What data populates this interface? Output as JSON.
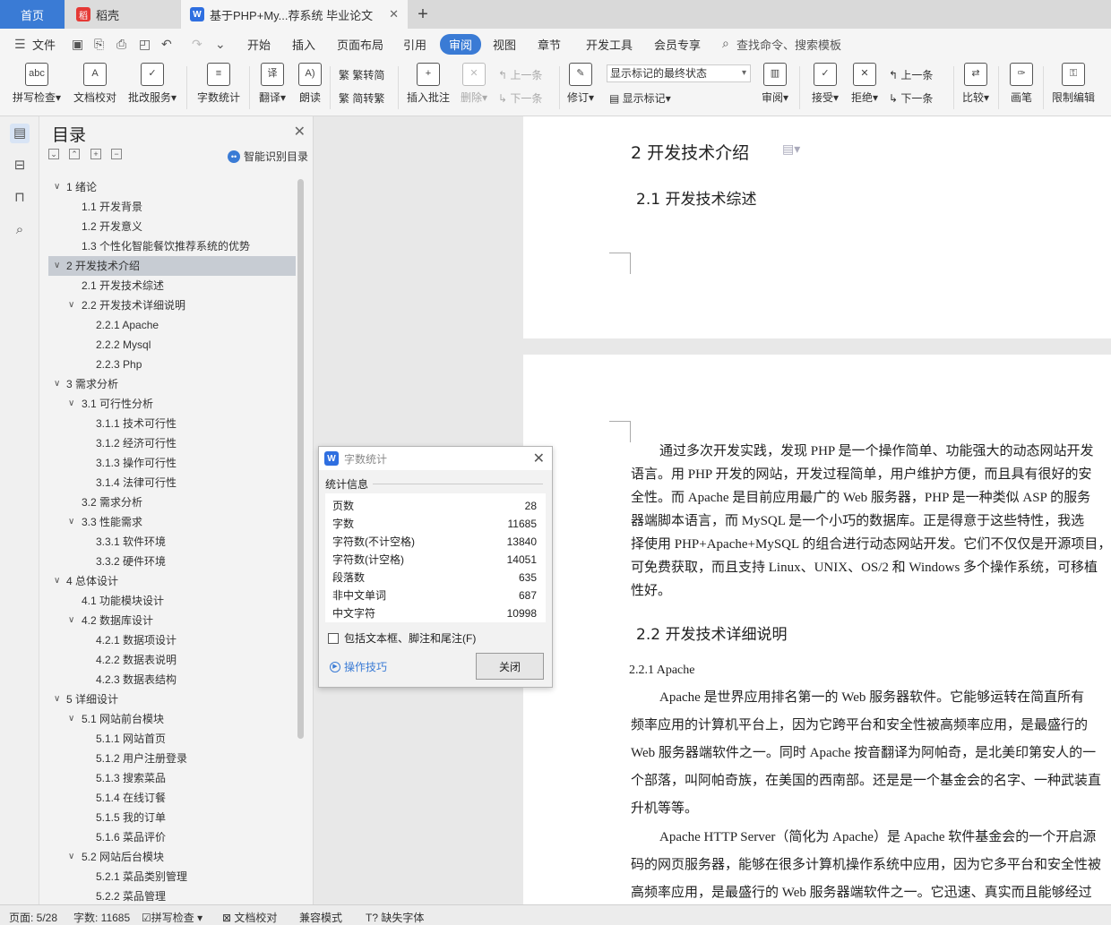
{
  "tabs": {
    "home": "首页",
    "daoke": "稻壳",
    "doc": "基于PHP+My...荐系统 毕业论文"
  },
  "menu": {
    "file": "文件",
    "items": [
      "开始",
      "插入",
      "页面布局",
      "引用",
      "审阅",
      "视图",
      "章节",
      "开发工具",
      "会员专享"
    ],
    "search": "查找命令、搜索模板"
  },
  "ribbon": {
    "spell": "拼写检查",
    "proof": "文档校对",
    "batch": "批改服务",
    "wordcount": "字数统计",
    "translate": "翻译",
    "read": "朗读",
    "trad": "繁转简",
    "simp": "简转繁",
    "insert_comment": "插入批注",
    "delete": "删除",
    "prev": "上一条",
    "next": "下一条",
    "revise": "修订",
    "markup_state": "显示标记的最终状态",
    "show_markup": "显示标记",
    "review": "审阅",
    "accept": "接受",
    "reject": "拒绝",
    "prev2": "上一条",
    "next2": "下一条",
    "compare": "比较",
    "pen": "画笔",
    "restrict": "限制编辑"
  },
  "toc": {
    "title": "目录",
    "smart": "智能识别目录",
    "items": [
      {
        "t": "1  绪论",
        "l": 1
      },
      {
        "t": "1.1  开发背景",
        "l": 2
      },
      {
        "t": "1.2  开发意义",
        "l": 2
      },
      {
        "t": "1.3  个性化智能餐饮推荐系统的优势",
        "l": 2
      },
      {
        "t": "2  开发技术介绍",
        "l": 1
      },
      {
        "t": "2.1  开发技术综述",
        "l": 2
      },
      {
        "t": "2.2  开发技术详细说明",
        "l": 2,
        "c": 1
      },
      {
        "t": "2.2.1  Apache",
        "l": 3
      },
      {
        "t": "2.2.2  Mysql",
        "l": 3
      },
      {
        "t": "2.2.3  Php",
        "l": 3
      },
      {
        "t": "3  需求分析",
        "l": 1
      },
      {
        "t": "3.1  可行性分析",
        "l": 2,
        "c": 1
      },
      {
        "t": "3.1.1  技术可行性",
        "l": 3
      },
      {
        "t": "3.1.2  经济可行性",
        "l": 3
      },
      {
        "t": "3.1.3  操作可行性",
        "l": 3
      },
      {
        "t": "3.1.4  法律可行性",
        "l": 3
      },
      {
        "t": "3.2  需求分析",
        "l": 2
      },
      {
        "t": "3.3  性能需求",
        "l": 2,
        "c": 1
      },
      {
        "t": "3.3.1  软件环境",
        "l": 3
      },
      {
        "t": "3.3.2  硬件环境",
        "l": 3
      },
      {
        "t": "4  总体设计",
        "l": 1
      },
      {
        "t": "4.1  功能模块设计",
        "l": 2
      },
      {
        "t": "4.2  数据库设计",
        "l": 2,
        "c": 1
      },
      {
        "t": "4.2.1  数据项设计",
        "l": 3
      },
      {
        "t": "4.2.2  数据表说明",
        "l": 3
      },
      {
        "t": "4.2.3  数据表结构",
        "l": 3
      },
      {
        "t": "5  详细设计",
        "l": 1
      },
      {
        "t": "5.1  网站前台模块",
        "l": 2,
        "c": 1
      },
      {
        "t": "5.1.1  网站首页",
        "l": 3
      },
      {
        "t": "5.1.2  用户注册登录",
        "l": 3
      },
      {
        "t": "5.1.3  搜索菜品",
        "l": 3
      },
      {
        "t": "5.1.4  在线订餐",
        "l": 3
      },
      {
        "t": "5.1.5  我的订单",
        "l": 3
      },
      {
        "t": "5.1.6  菜品评价",
        "l": 3
      },
      {
        "t": "5.2  网站后台模块",
        "l": 2,
        "c": 1
      },
      {
        "t": "5.2.1  菜品类别管理",
        "l": 3
      },
      {
        "t": "5.2.2  菜品管理",
        "l": 3
      }
    ]
  },
  "doc": {
    "h1": "2   开发技术介绍",
    "h21": "2.1   开发技术综述",
    "h22": "2.2   开发技术详细说明",
    "h3": "2.2.1    Apache",
    "p1": [
      "通过多次开发实践，发现 PHP 是一个操作简单、功能强大的动态网站开发",
      "语言。用 PHP 开发的网站，开发过程简单，用户维护方便，而且具有很好的安",
      "全性。而 Apache 是目前应用最广的 Web 服务器，PHP 是一种类似 ASP 的服务",
      "器端脚本语言，而  MySQL  是一个小巧的数据库。正是得意于这些特性，我选",
      "择使用 PHP+Apache+MySQL 的组合进行动态网站开发。它们不仅仅是开源项目，",
      "可免费获取，而且支持 Linux、UNIX、OS/2 和 Windows 多个操作系统，可移植",
      "性好。"
    ],
    "p2": [
      "Apache 是世界应用排名第一的 Web 服务器软件。它能够运转在简直所有",
      "频率应用的计算机平台上，因为它跨平台和安全性被高频率应用，是最盛行的",
      "Web 服务器端软件之一。同时 Apache 按音翻译为阿帕奇，是北美印第安人的一",
      "个部落，叫阿帕奇族，在美国的西南部。还是是一个基金会的名字、一种武装直",
      "升机等等。"
    ],
    "p3": [
      "Apache HTTP Server（简化为 Apache）是 Apache 软件基金会的一个开启源",
      "码的网页服务器，能够在很多计算机操作系统中应用，因为它多平台和安全性被",
      "高频率应用，是最盛行的 Web 服务器端软件之一。它迅速、真实而且能够经过"
    ]
  },
  "dialog": {
    "title": "字数统计",
    "section": "统计信息",
    "stats": [
      [
        "页数",
        "28"
      ],
      [
        "字数",
        "11685"
      ],
      [
        "字符数(不计空格)",
        "13840"
      ],
      [
        "字符数(计空格)",
        "14051"
      ],
      [
        "段落数",
        "635"
      ],
      [
        "非中文单词",
        "687"
      ],
      [
        "中文字符",
        "10998"
      ]
    ],
    "checkbox": "包括文本框、脚注和尾注(F)",
    "tips": "操作技巧",
    "close": "关闭"
  },
  "status": {
    "page": "页面: 5/28",
    "words": "字数: 11685",
    "spell": "拼写检查",
    "proof": "文档校对",
    "compat": "兼容模式",
    "font": "缺失字体"
  }
}
